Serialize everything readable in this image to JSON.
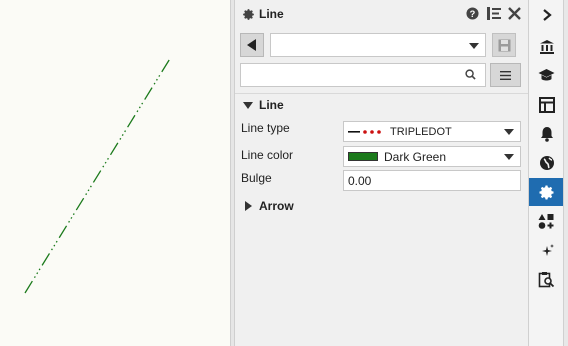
{
  "palette": {
    "title": "Line",
    "style_combo_value": "",
    "search_placeholder": ""
  },
  "sections": {
    "line": "Line",
    "arrow": "Arrow"
  },
  "properties": {
    "line_type_label": "Line type",
    "line_type_value": "TRIPLEDOT",
    "line_color_label": "Line color",
    "line_color_value": "Dark Green",
    "line_color_hex": "#1b7a1b",
    "bulge_label": "Bulge",
    "bulge_value": "0.00"
  },
  "toolbar": {
    "items": [
      "collapse-panel",
      "building",
      "graduation-cap",
      "layout",
      "bell",
      "globe",
      "gear",
      "shapes-plus",
      "sparkle",
      "clipboard-search"
    ],
    "active": "gear"
  },
  "colors": {
    "accent": "#1f6cb0",
    "line_green": "#1b7a1b",
    "line_dots": "#cc1111"
  }
}
